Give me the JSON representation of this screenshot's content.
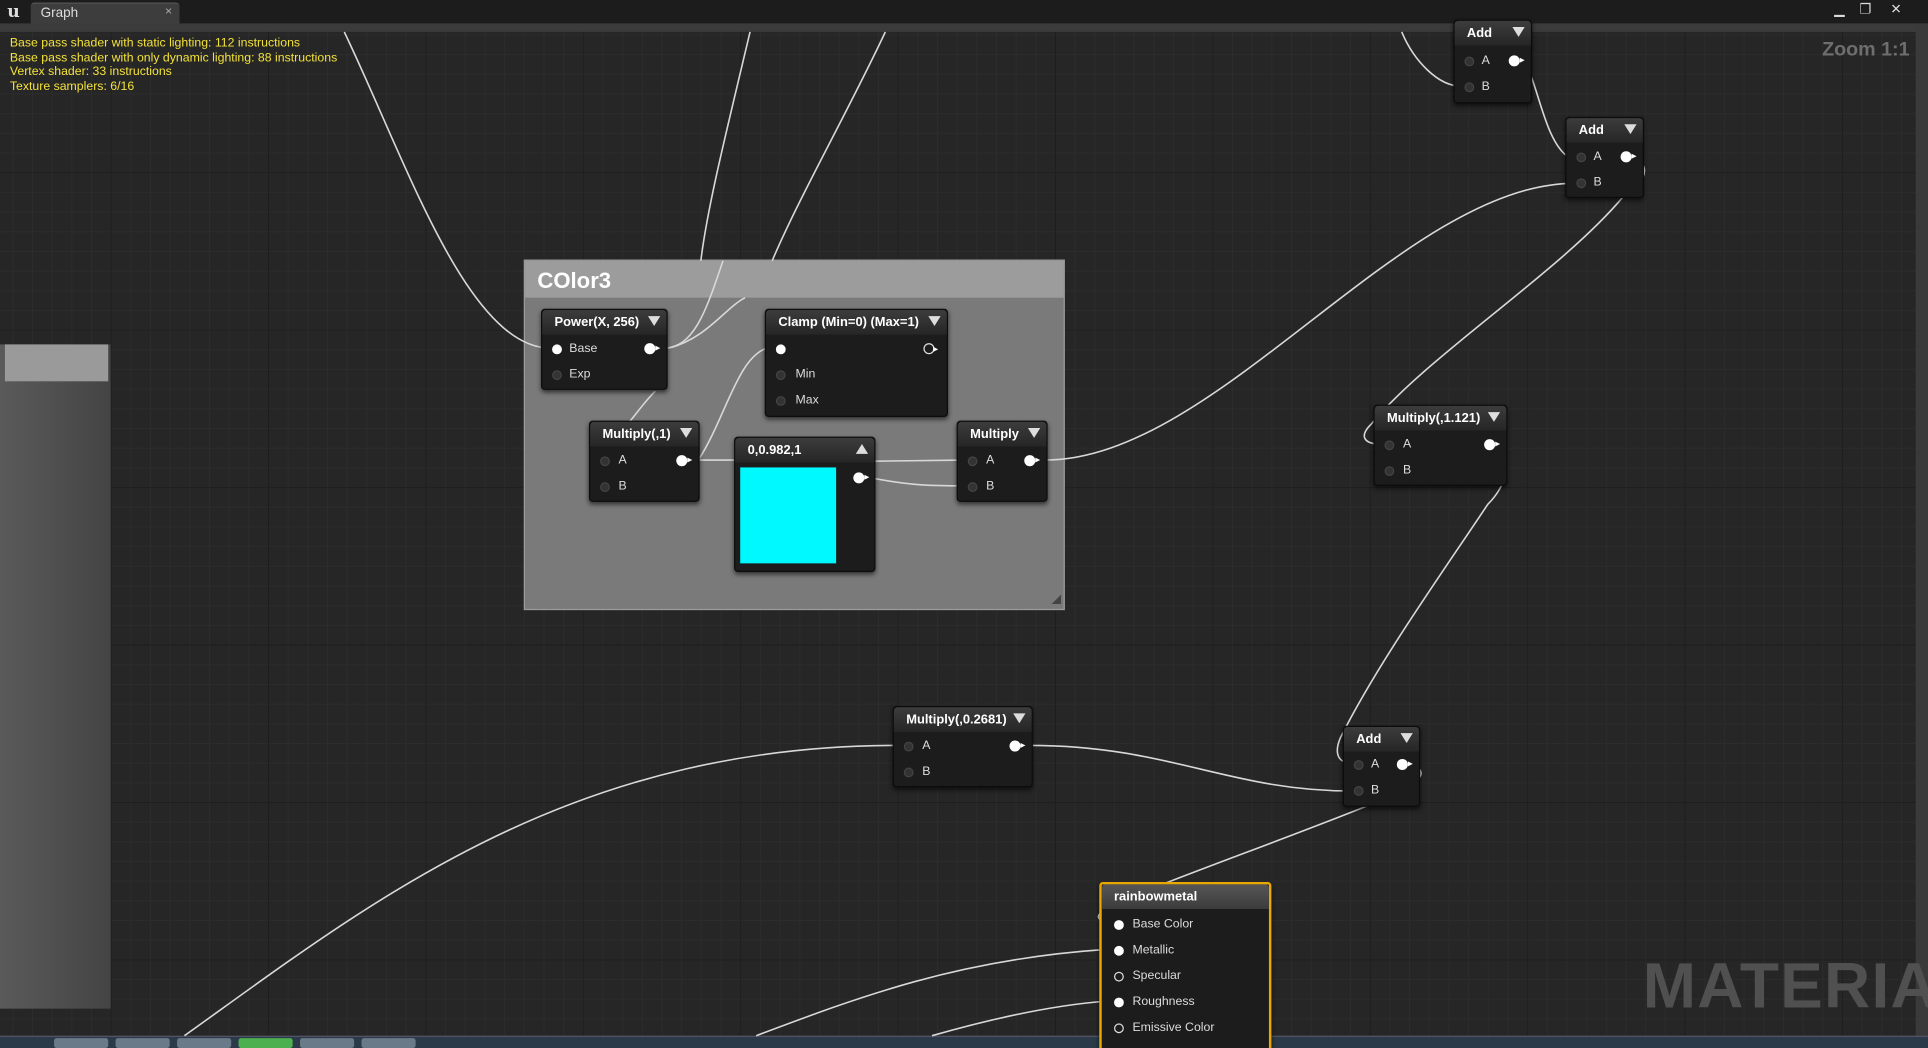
{
  "tab": {
    "label": "Graph",
    "close": "×"
  },
  "window_controls": {
    "minimize": "▁",
    "restore": "❐",
    "close": "✕"
  },
  "stats": [
    "Base pass shader with static lighting: 112 instructions",
    "Base pass shader with only dynamic lighting: 88 instructions",
    "Vertex shader: 33 instructions",
    "Texture samplers: 6/16"
  ],
  "zoom": "Zoom 1:1",
  "watermark": "MATERIAL",
  "comment": {
    "title": "COlor3"
  },
  "nodes": {
    "add_top": {
      "title": "Add",
      "pins": [
        "A",
        "B"
      ]
    },
    "add_right": {
      "title": "Add",
      "pins": [
        "A",
        "B"
      ]
    },
    "power": {
      "title": "Power(X, 256)",
      "pins": [
        "Base",
        "Exp"
      ]
    },
    "clamp": {
      "title": "Clamp (Min=0) (Max=1)",
      "pins": [
        "Min",
        "Max"
      ]
    },
    "multiply1": {
      "title": "Multiply(,1)",
      "pins": [
        "A",
        "B"
      ]
    },
    "constant": {
      "title": "0,0.982,1",
      "color": "#00f9ff"
    },
    "multiply_main": {
      "title": "Multiply",
      "pins": [
        "A",
        "B"
      ]
    },
    "multiply_1121": {
      "title": "Multiply(,1.121)",
      "pins": [
        "A",
        "B"
      ]
    },
    "multiply_02681": {
      "title": "Multiply(,0.2681)",
      "pins": [
        "A",
        "B"
      ]
    },
    "add_lower": {
      "title": "Add",
      "pins": [
        "A",
        "B"
      ]
    },
    "result": {
      "title": "rainbowmetal",
      "pins": [
        "Base Color",
        "Metallic",
        "Specular",
        "Roughness",
        "Emissive Color"
      ]
    }
  },
  "colors": {
    "stats": "#f3e23a",
    "result_border": "#e8a800",
    "swatch": "#00f9ff"
  }
}
